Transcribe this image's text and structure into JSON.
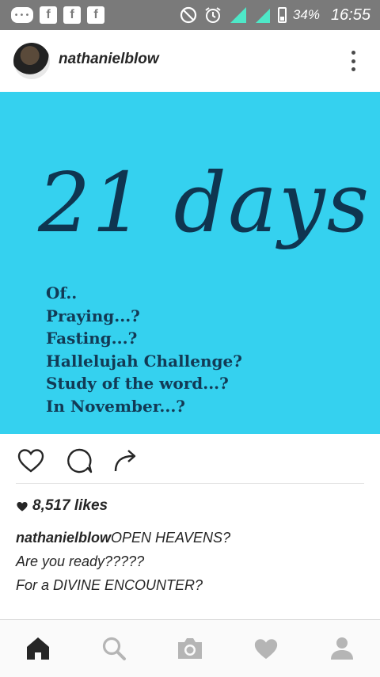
{
  "status_bar": {
    "battery_percent": "34%",
    "time": "16:55",
    "notification_icons": [
      "message-icon",
      "facebook-icon",
      "facebook-icon",
      "facebook-icon"
    ],
    "system_icons": [
      "do-not-disturb-icon",
      "alarm-icon",
      "signal-icon",
      "signal-icon",
      "battery-icon"
    ]
  },
  "post": {
    "username": "nathanielblow",
    "image": {
      "background_color": "#35d1ef",
      "title": "21 days",
      "lines": [
        "Of..",
        "Praying...?",
        "Fasting...?",
        "Hallelujah Challenge?",
        "Study of the word...?",
        "In November...?"
      ]
    },
    "likes": "8,517 likes",
    "caption": {
      "username": "nathanielblow",
      "line1": "OPEN HEAVENS?",
      "line2": "Are you ready?????",
      "line3": "For a DIVINE ENCOUNTER?"
    }
  },
  "actions": [
    "heart-icon",
    "comment-icon",
    "share-icon"
  ],
  "bottom_nav": [
    "home-icon",
    "search-icon",
    "camera-icon",
    "heart-icon",
    "profile-icon"
  ]
}
